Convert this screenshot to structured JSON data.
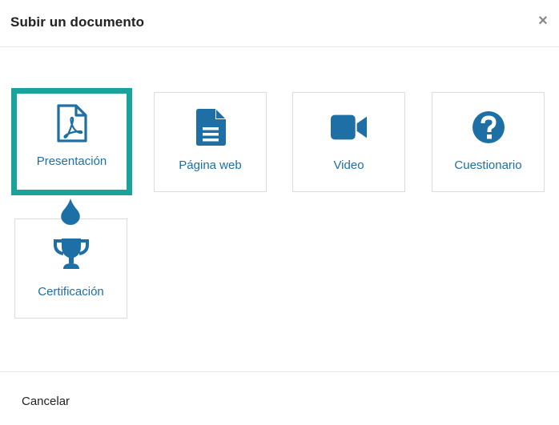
{
  "dialog": {
    "title": "Subir un documento",
    "close_glyph": "×",
    "cancel_label": "Cancelar"
  },
  "options": [
    {
      "label": "Presentación",
      "icon": "file-pdf-icon",
      "selected": true
    },
    {
      "label": "Página web",
      "icon": "file-text-icon",
      "selected": false
    },
    {
      "label": "Video",
      "icon": "video-camera-icon",
      "selected": false
    },
    {
      "label": "Cuestionario",
      "icon": "question-circle-icon",
      "selected": false
    },
    {
      "label": "Certificación",
      "icon": "trophy-icon",
      "selected": false
    }
  ],
  "colors": {
    "accent_blue": "#1d6fa5",
    "selection_teal": "#1aa39b"
  }
}
